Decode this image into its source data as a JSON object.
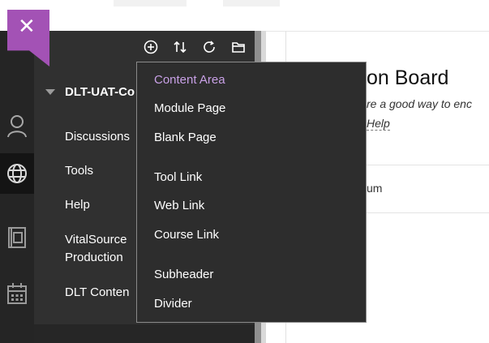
{
  "close_icon": "close-icon",
  "rail": {
    "items": [
      {
        "name": "profile-icon",
        "active": false
      },
      {
        "name": "globe-icon",
        "active": true
      },
      {
        "name": "book-icon",
        "active": false
      },
      {
        "name": "calendar-icon",
        "active": false
      }
    ]
  },
  "toolbar": {
    "buttons": [
      {
        "name": "add-menu-item-icon"
      },
      {
        "name": "reorder-icon"
      },
      {
        "name": "refresh-icon"
      },
      {
        "name": "folder-icon"
      }
    ]
  },
  "course": {
    "title": "DLT-UAT-Co",
    "items": [
      "Discussions",
      "Tools",
      "Help",
      "VitalSource",
      "Production",
      "DLT Conten"
    ]
  },
  "content": {
    "title": "on Board",
    "description": "re a good way to enc",
    "help_link": "Help",
    "row_text": "um"
  },
  "dropdown": {
    "groups": [
      [
        "Content Area",
        "Module Page",
        "Blank Page"
      ],
      [
        "Tool Link",
        "Web Link",
        "Course Link"
      ],
      [
        "Subheader",
        "Divider"
      ]
    ],
    "selected": "Content Area"
  },
  "colors": {
    "accent": "#a352b5",
    "selected_text": "#c8a0e6",
    "panel": "#303030",
    "rail": "#252525"
  }
}
